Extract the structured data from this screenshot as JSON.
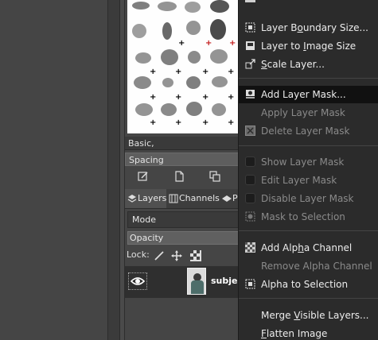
{
  "brushes": {
    "preset_name": "Basic,",
    "spacing_label": "Spacing"
  },
  "tabs": [
    {
      "label": "Layers"
    },
    {
      "label": "Channels"
    },
    {
      "label": "P"
    }
  ],
  "layers": {
    "mode_label": "Mode",
    "opacity_label": "Opacity",
    "lock_label": "Lock:",
    "layer_name": "subjec"
  },
  "menu": {
    "items": [
      {
        "label": "Layer Boundary Size...",
        "u": "o",
        "enabled": true
      },
      {
        "label": "Layer to Image Size",
        "u": "I",
        "enabled": true
      },
      {
        "label": "Scale Layer...",
        "u": "S",
        "enabled": true
      },
      {
        "label": "Add Layer Mask...",
        "enabled": true,
        "highlighted": true
      },
      {
        "label": "Apply Layer Mask",
        "enabled": false
      },
      {
        "label": "Delete Layer Mask",
        "enabled": false
      },
      {
        "label": "Show Layer Mask",
        "enabled": false
      },
      {
        "label": "Edit Layer Mask",
        "enabled": false
      },
      {
        "label": "Disable Layer Mask",
        "enabled": false
      },
      {
        "label": "Mask to Selection",
        "enabled": false
      },
      {
        "label": "Add Alpha Channel",
        "u": "h",
        "enabled": true
      },
      {
        "label": "Remove Alpha Channel",
        "enabled": false
      },
      {
        "label": "Alpha to Selection",
        "enabled": true
      },
      {
        "label": "Merge Visible Layers...",
        "u": "V",
        "enabled": true
      },
      {
        "label": "Flatten Image",
        "u": "F",
        "enabled": true
      }
    ]
  }
}
